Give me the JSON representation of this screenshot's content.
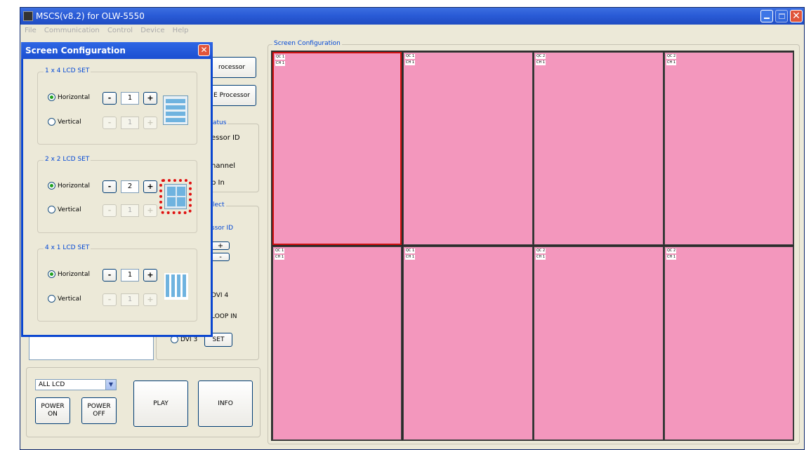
{
  "window": {
    "title": "MSCS(v8.2) for OLW-5550"
  },
  "menu": [
    "File",
    "Communication",
    "Control",
    "Device",
    "Help"
  ],
  "screen_config_group": "Screen Configuration",
  "cells": [
    {
      "qc": "QC 1",
      "ch": "CH 1"
    },
    {
      "qc": "QC 1",
      "ch": "CH 1"
    },
    {
      "qc": "QC 2",
      "ch": "CH 1"
    },
    {
      "qc": "QC 2",
      "ch": "CH 1"
    },
    {
      "qc": "QC 1",
      "ch": "CH 1"
    },
    {
      "qc": "QC 1",
      "ch": "CH 1"
    },
    {
      "qc": "QC 2",
      "ch": "CH 1"
    },
    {
      "qc": "QC 2",
      "ch": "CH 1"
    }
  ],
  "back": {
    "processor_btn1": "rocessor",
    "processor_btn2": "E Processor",
    "status_label": "atus",
    "status_id": "essor ID",
    "status_channel": "hannel",
    "status_loop": "p In",
    "select_label": "lect",
    "select_id_label": "ssor ID",
    "plus": "+",
    "minus": "-",
    "dvi4": "DVI 4",
    "loopin": "LOOP IN",
    "dvi3": "DVI 3",
    "set": "SET"
  },
  "bottom": {
    "select_value": "ALL LCD",
    "power_on": "POWER\nON",
    "power_off": "POWER\nOFF",
    "play": "PLAY",
    "info": "INFO"
  },
  "dialog": {
    "title": "Screen Configuration",
    "close": "✕",
    "sections": [
      {
        "label": "1 x 4  LCD  SET",
        "horizontal": "Horizontal",
        "vertical": "Vertical",
        "h_value": "1",
        "v_value": "1",
        "selected": "horizontal"
      },
      {
        "label": "2 x 2  LCD  SET",
        "horizontal": "Horizontal",
        "vertical": "Vertical",
        "h_value": "2",
        "v_value": "1",
        "selected": "horizontal"
      },
      {
        "label": "4 x 1  LCD  SET",
        "horizontal": "Horizontal",
        "vertical": "Vertical",
        "h_value": "1",
        "v_value": "1",
        "selected": "horizontal"
      }
    ],
    "minus": "-",
    "plus": "+"
  },
  "colors": {
    "cell": "#f397bd",
    "selected_border": "#d01010",
    "highlight": "#e01010"
  }
}
